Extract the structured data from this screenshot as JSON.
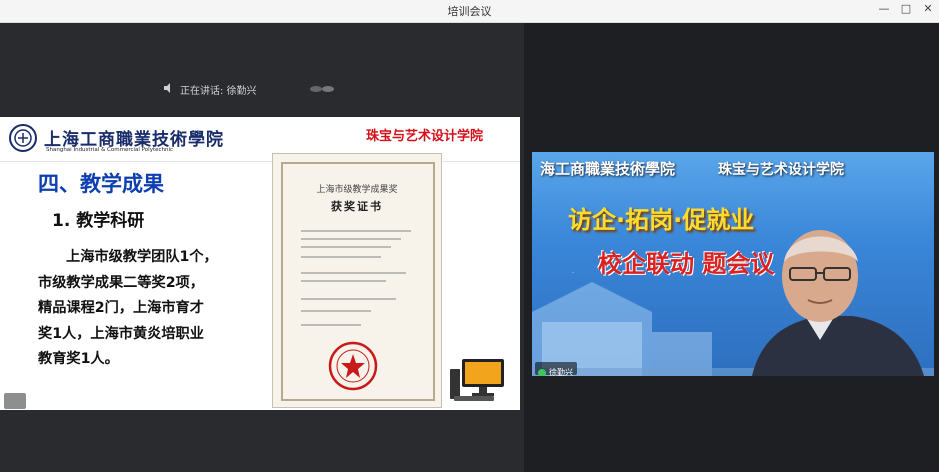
{
  "window": {
    "title": "培训会议",
    "controls": [
      "—",
      "□",
      "✕"
    ]
  },
  "share_bar": {
    "label": "正在讲话: 徐勤兴"
  },
  "slide": {
    "school_name_cn": "上海工商職業技術學院",
    "school_name_en": "Shanghai Industrial & Commercial Polytechnic",
    "college_name": "珠宝与艺术设计学院",
    "heading": "四、教学成果",
    "subheading": "1. 教学科研",
    "body_lines": [
      "上海市级教学团队1个，",
      "市级教学成果二等奖2项，",
      "精品课程2门，上海市育才",
      "奖1人，上海市黄炎培职业",
      "教育奖1人。"
    ],
    "certificate": {
      "title": "上海市级教学成果奖",
      "subtitle": "获奖证书"
    }
  },
  "video": {
    "banner_school": "海工商職業技術學院",
    "banner_college": "珠宝与艺术设计学院",
    "slogan": "访企·拓岗·促就业",
    "meeting_title": "校企联动 题会议",
    "participant_name": "徐勤兴"
  },
  "colors": {
    "heading_blue": "#0d3fb0",
    "college_red": "#d4101a",
    "slogan_yellow": "#ffdb2a",
    "meeting_red": "#d92222",
    "mic_green": "#3ec85a"
  }
}
